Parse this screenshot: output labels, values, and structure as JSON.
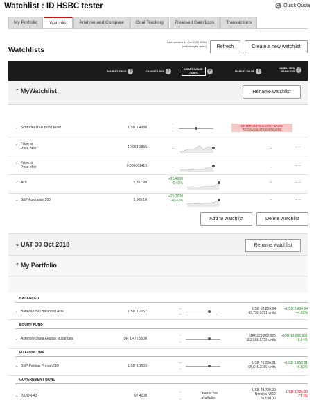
{
  "page": {
    "title": "Watchlist : ID HSBC tester",
    "quick_quote": "Quick Quote"
  },
  "tabs": [
    "My Portfolio",
    "Watchlist",
    "Analyse and Compare",
    "Goal Tracking",
    "Realised Gain/Loss",
    "Transactions"
  ],
  "header": {
    "title": "Watchlists",
    "updated_line1": "Last updated 31 Oct 2018 20:54",
    "updated_line2": "(with delayed data*)",
    "refresh": "Refresh",
    "create": "Create a new watchlist"
  },
  "columns": {
    "market_price": "MARKET PRICE",
    "change": "CHANGE 1 DAY",
    "chart_range_1": "CHART RANGE",
    "chart_range_2": "7 DAYS",
    "market_value": "MARKET VALUE",
    "unrealised_1": "UNREALISED",
    "unrealised_2": "GAIN/LOSS"
  },
  "mywatchlist": {
    "name": "MyWatchlist",
    "rename": "Rename watchlist",
    "add": "Add to watchlist",
    "delete": "Delete watchlist",
    "warning_1": "ENTER UNITS & COST BASIS",
    "warning_2": "TO CALCULATE GAIN/LOSS",
    "rows": [
      {
        "name": "Schroder USD Bond Fund",
        "name2": "",
        "price": "USD 1.4980",
        "chg1": "",
        "chg2": ""
      },
      {
        "name": "From to",
        "name2": "Price of in",
        "price": "10,068.3865",
        "chg1": "",
        "chg2": ""
      },
      {
        "name": "From to",
        "name2": "Price of in",
        "price": "0.000061419",
        "chg1": "",
        "chg2": ""
      },
      {
        "name": "AOI",
        "name2": "",
        "price": "5,887.90",
        "chg1": "+25.4000",
        "chg2": "+0.43%"
      },
      {
        "name": "S&P Australian 200",
        "name2": "",
        "price": "5,905.10",
        "chg1": "+25.2000",
        "chg2": "+0.43%"
      }
    ]
  },
  "uat": {
    "name": "UAT 30 Oct 2018",
    "rename": "Rename watchlist"
  },
  "portfolio": {
    "name": "My Portfolio",
    "groups": [
      {
        "cat": "BALANCED",
        "name": "Batavia USD Balanced Asia",
        "price": "USD 1.2057",
        "mv1": "USD 52,809.64",
        "mv2": "43,799.9791 units",
        "gl1": "+USD 2,434.64",
        "gl2": "+4.83%",
        "pos": "g"
      },
      {
        "cat": "EQUITY FUND",
        "name": "Ashmore Dana Ekuitas Nusantara",
        "price": "IDR 1,472.9900",
        "mv1": "IDR 226,202,026",
        "mv2": "153,566.5728 units",
        "gl1": "+IDR 13,891,901",
        "gl2": "+6.54%",
        "pos": "g"
      },
      {
        "cat": "FIXED INCOME",
        "name": "BNP Paribas Prima USD",
        "price": "USD 1.1609",
        "mv1": "USD 76,206.81",
        "mv2": "65,646.3169 units",
        "gl1": "+USD 3,852.81",
        "gl2": "+5.33%",
        "pos": "g"
      },
      {
        "cat": "GOVERNMENT BOND",
        "name": "INDON-43",
        "price": "97.4000",
        "mv1": "USD 48,700.00",
        "mv2": "Nominal USD",
        "mv3": "50,000.00",
        "gl1": "-USD 3,725.00",
        "gl2": "-7.11%",
        "pos": "r",
        "chart1": "Chart is not",
        "chart2": "available."
      }
    ]
  },
  "colors": {
    "accent": "#db0011",
    "header_bg": "#1b1b1b",
    "gain": "#2a8a2a"
  }
}
